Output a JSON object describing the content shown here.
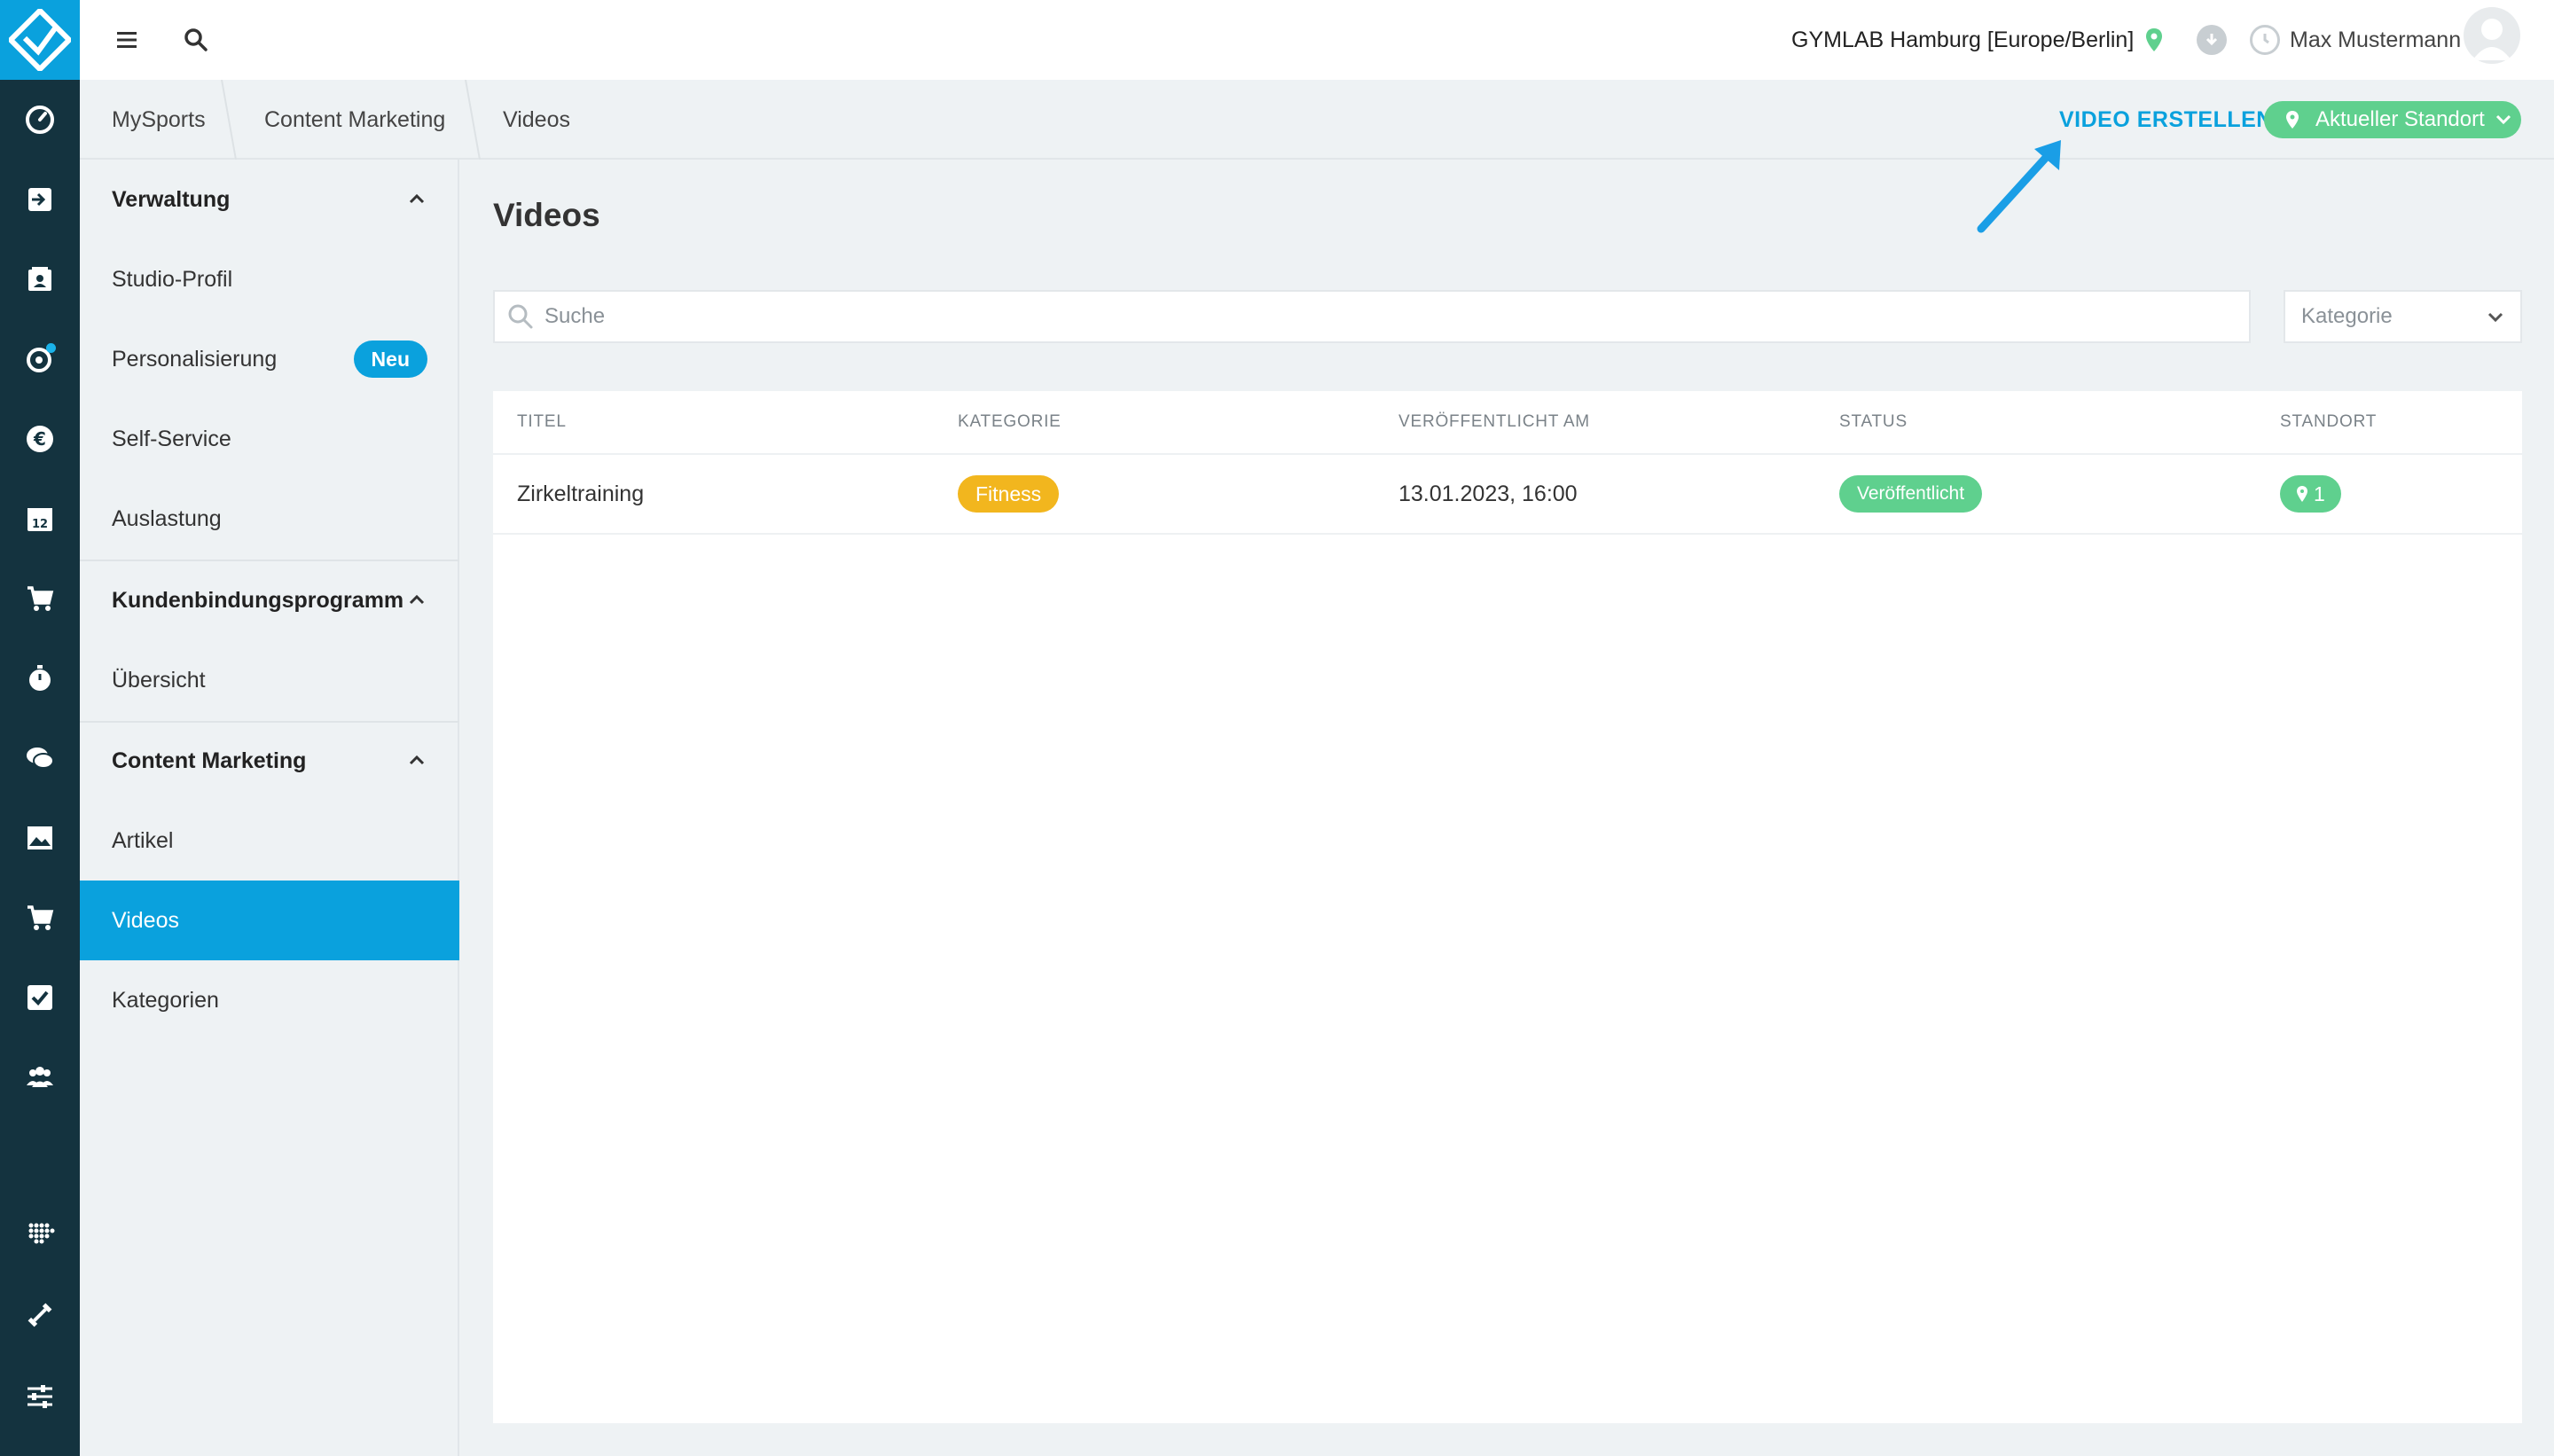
{
  "topbar": {
    "location": "GYMLAB Hamburg [Europe/Berlin]",
    "username": "Max Mustermann"
  },
  "breadcrumb": [
    "MySports",
    "Content Marketing",
    "Videos"
  ],
  "actions": {
    "create_label": "VIDEO ERSTELLEN",
    "standort_label": "Aktueller Standort"
  },
  "sidebar": {
    "sections": [
      {
        "title": "Verwaltung",
        "items": [
          "Studio-Profil",
          "Personalisierung",
          "Self-Service",
          "Auslastung"
        ]
      },
      {
        "title": "Kundenbindungsprogramm",
        "items": [
          "Übersicht"
        ]
      },
      {
        "title": "Content Marketing",
        "items": [
          "Artikel",
          "Videos",
          "Kategorien"
        ]
      }
    ],
    "badge_neu": "Neu",
    "active_item": "Videos"
  },
  "main": {
    "title": "Videos",
    "search_placeholder": "Suche",
    "category_placeholder": "Kategorie"
  },
  "table": {
    "headers": [
      "TITEL",
      "KATEGORIE",
      "VERÖFFENTLICHT AM",
      "STATUS",
      "STANDORT"
    ],
    "rows": [
      {
        "title": "Zirkeltraining",
        "category": "Fitness",
        "published": "13.01.2023, 16:00",
        "status": "Veröffentlicht",
        "locations": "1"
      }
    ]
  },
  "colors": {
    "accent": "#0aa1dd",
    "rail": "#14333f",
    "success": "#5fd08e",
    "category_yellow": "#f2b61e"
  },
  "rail_icons": [
    "dashboard-icon",
    "check-in-icon",
    "contacts-icon",
    "campaign-icon",
    "euro-icon",
    "calendar-icon",
    "shop-cart-icon",
    "stopwatch-icon",
    "chat-icon",
    "image-icon",
    "cart-icon",
    "checkbox-icon",
    "group-icon",
    "dots-grid-icon",
    "dumbbell-icon",
    "sliders-icon"
  ]
}
